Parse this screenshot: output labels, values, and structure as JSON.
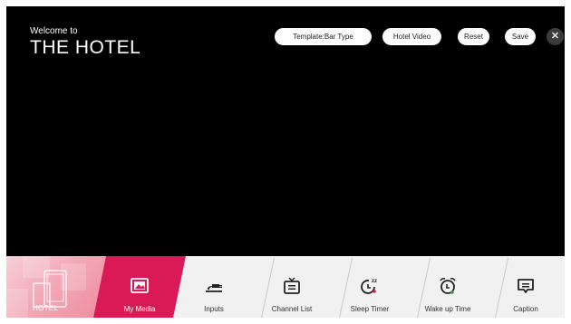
{
  "header": {
    "welcome": "Welcome to",
    "hotel_name": "THE HOTEL"
  },
  "toolbar": {
    "template_label": "Template:Bar Type",
    "hotel_video_label": "Hotel Video",
    "reset_label": "Reset",
    "save_label": "Save",
    "close_symbol": "✕"
  },
  "launcher": {
    "hotel_label": "HOTEL",
    "items": [
      {
        "label": "My Media",
        "icon": "my-media-icon",
        "active": true
      },
      {
        "label": "Inputs",
        "icon": "inputs-icon",
        "active": false
      },
      {
        "label": "Channel List",
        "icon": "channel-list-icon",
        "active": false
      },
      {
        "label": "Sleep Timer",
        "icon": "sleep-timer-icon",
        "active": false
      },
      {
        "label": "Wake up Time",
        "icon": "wake-up-time-icon",
        "active": false
      },
      {
        "label": "Caption",
        "icon": "caption-icon",
        "active": false
      }
    ]
  },
  "colors": {
    "accent": "#d91a57",
    "background": "#000000",
    "launcher_bg": "#f1f1f1"
  }
}
